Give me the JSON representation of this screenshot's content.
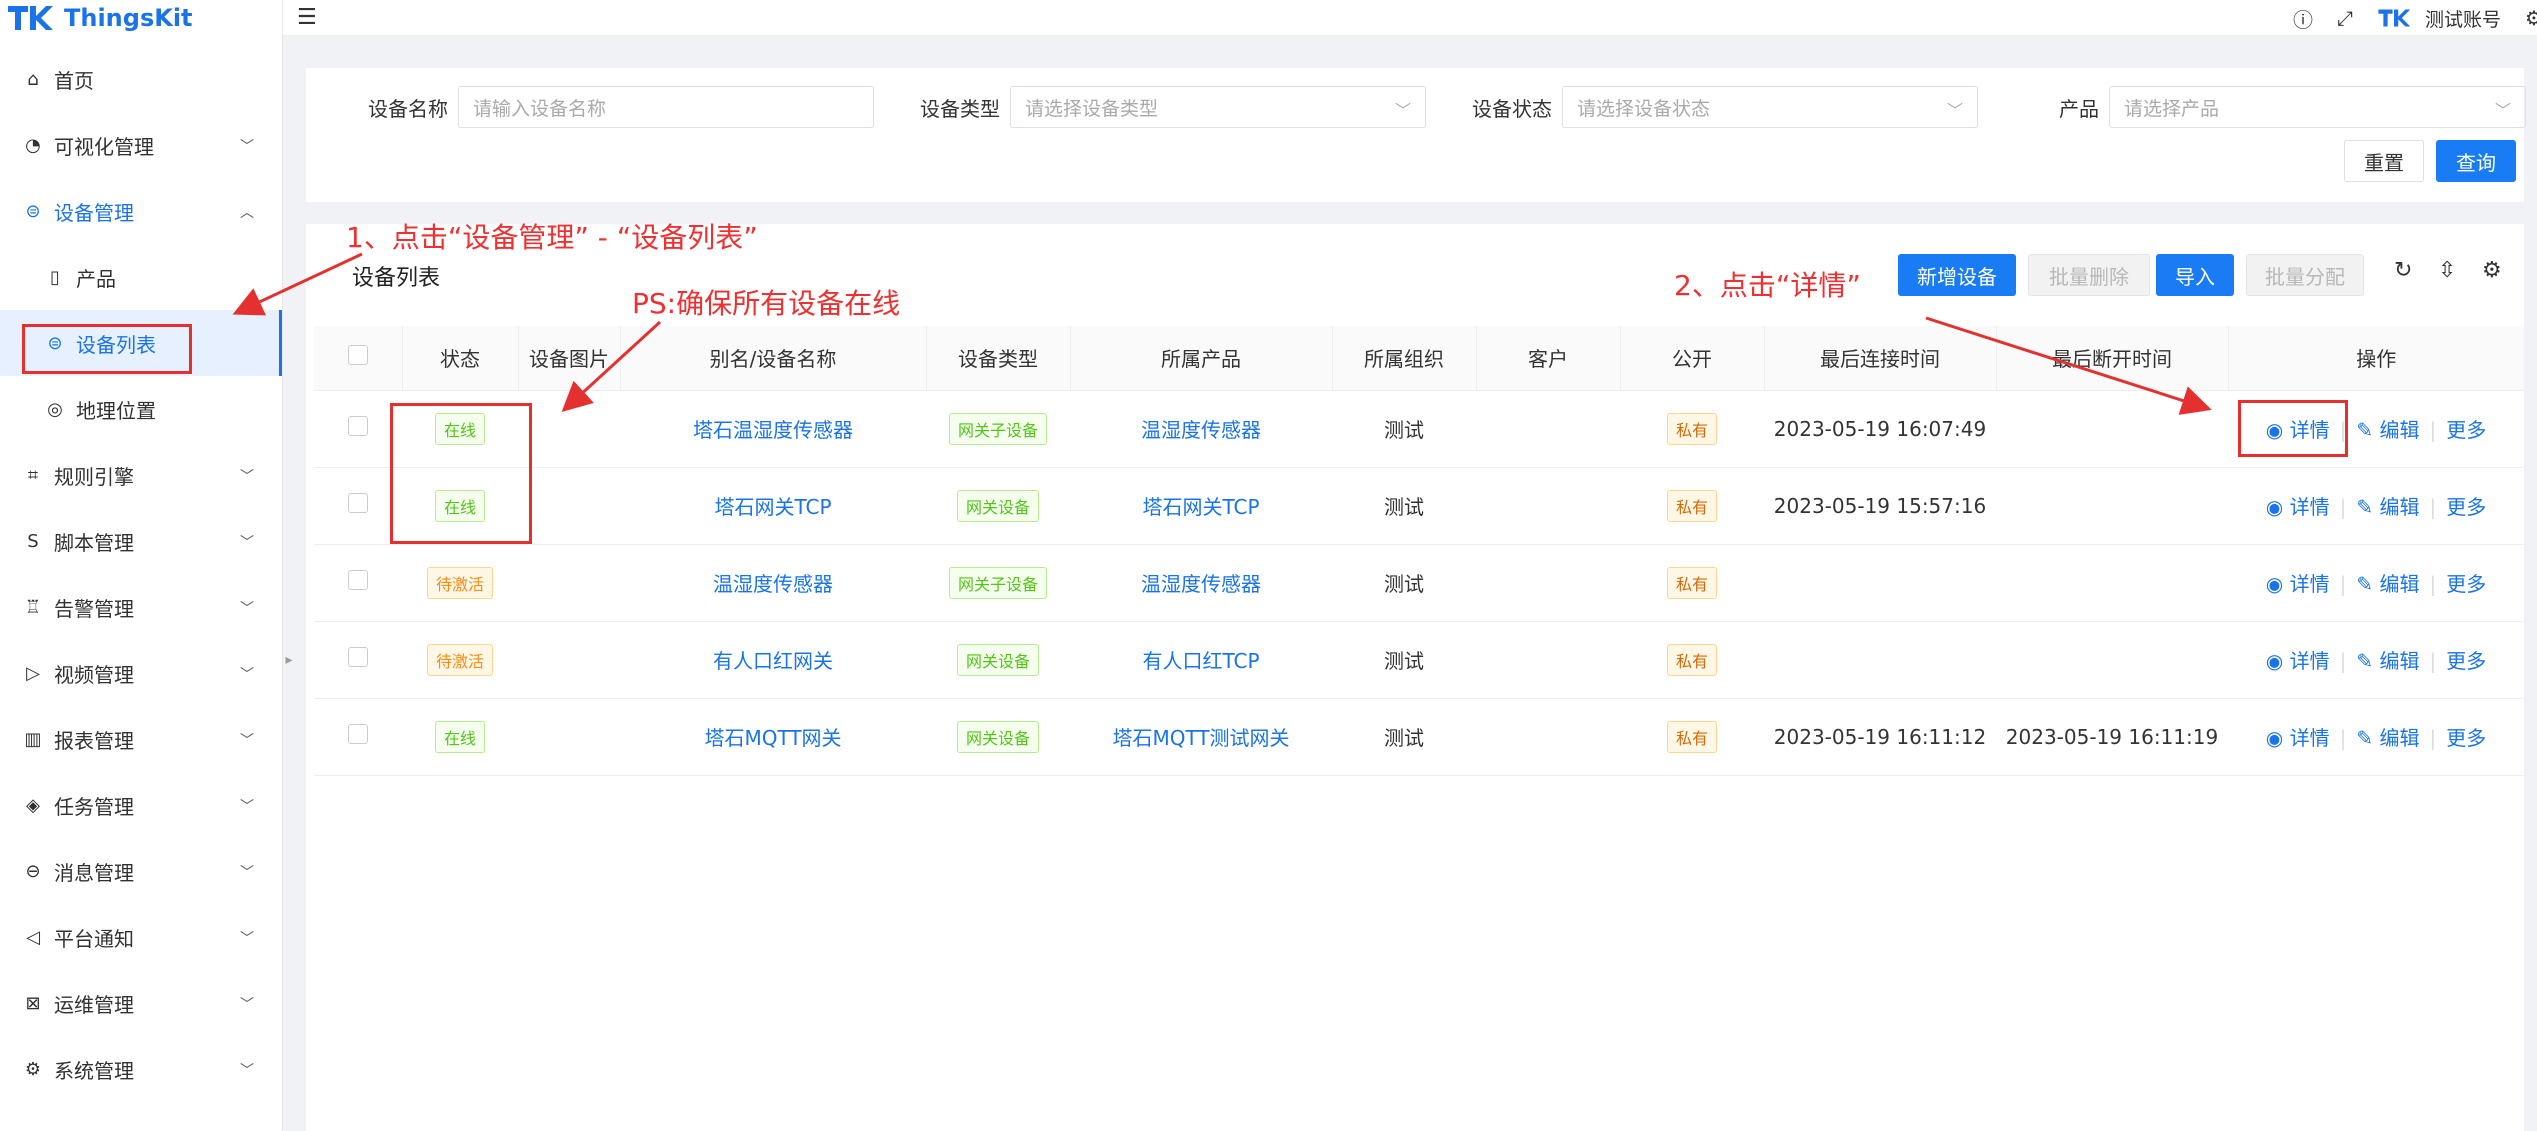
{
  "app": {
    "name": "ThingsKit",
    "account": "测试账号"
  },
  "sidebar": {
    "items": [
      {
        "label": "首页",
        "icon": "home-icon",
        "glyph": "⌂"
      },
      {
        "label": "可视化管理",
        "icon": "dashboard-icon",
        "glyph": "◔"
      },
      {
        "label": "设备管理",
        "icon": "device-icon",
        "glyph": "⊜"
      },
      {
        "label": "产品",
        "icon": "file-icon",
        "glyph": "▯"
      },
      {
        "label": "设备列表",
        "icon": "device-list-icon",
        "glyph": "⊜"
      },
      {
        "label": "地理位置",
        "icon": "location-icon",
        "glyph": "◎"
      },
      {
        "label": "规则引擎",
        "icon": "rule-icon",
        "glyph": "⌗"
      },
      {
        "label": "脚本管理",
        "icon": "script-icon",
        "glyph": "S"
      },
      {
        "label": "告警管理",
        "icon": "alarm-icon",
        "glyph": "♖"
      },
      {
        "label": "视频管理",
        "icon": "video-icon",
        "glyph": "▷"
      },
      {
        "label": "报表管理",
        "icon": "report-icon",
        "glyph": "▥"
      },
      {
        "label": "任务管理",
        "icon": "task-icon",
        "glyph": "◈"
      },
      {
        "label": "消息管理",
        "icon": "message-icon",
        "glyph": "⊖"
      },
      {
        "label": "平台通知",
        "icon": "notice-icon",
        "glyph": "◁"
      },
      {
        "label": "运维管理",
        "icon": "ops-icon",
        "glyph": "⊠"
      },
      {
        "label": "系统管理",
        "icon": "settings-icon",
        "glyph": "⚙"
      }
    ]
  },
  "search": {
    "device_name_label": "设备名称",
    "device_name_placeholder": "请输入设备名称",
    "device_type_label": "设备类型",
    "device_type_placeholder": "请选择设备类型",
    "device_status_label": "设备状态",
    "device_status_placeholder": "请选择设备状态",
    "product_label": "产品",
    "product_placeholder": "请选择产品",
    "reset": "重置",
    "query": "查询"
  },
  "table": {
    "title": "设备列表",
    "actions": {
      "add": "新增设备",
      "batch_delete": "批量删除",
      "import": "导入",
      "batch_assign": "批量分配"
    },
    "columns": [
      "状态",
      "设备图片",
      "别名/设备名称",
      "设备类型",
      "所属产品",
      "所属组织",
      "客户",
      "公开",
      "最后连接时间",
      "最后断开时间",
      "操作"
    ],
    "ops": {
      "detail": "详情",
      "edit": "编辑",
      "more": "更多"
    },
    "rows": [
      {
        "status": "在线",
        "status_type": "online",
        "name": "塔石温湿度传感器",
        "type": "网关子设备",
        "product": "温湿度传感器",
        "org": "测试",
        "customer": "",
        "public": "私有",
        "last_connect": "2023-05-19 16:07:49",
        "last_disconnect": ""
      },
      {
        "status": "在线",
        "status_type": "online",
        "name": "塔石网关TCP",
        "type": "网关设备",
        "product": "塔石网关TCP",
        "org": "测试",
        "customer": "",
        "public": "私有",
        "last_connect": "2023-05-19 15:57:16",
        "last_disconnect": ""
      },
      {
        "status": "待激活",
        "status_type": "pending",
        "name": "温湿度传感器",
        "type": "网关子设备",
        "product": "温湿度传感器",
        "org": "测试",
        "customer": "",
        "public": "私有",
        "last_connect": "",
        "last_disconnect": ""
      },
      {
        "status": "待激活",
        "status_type": "pending",
        "name": "有人口红网关",
        "type": "网关设备",
        "product": "有人口红TCP",
        "org": "测试",
        "customer": "",
        "public": "私有",
        "last_connect": "",
        "last_disconnect": ""
      },
      {
        "status": "在线",
        "status_type": "online",
        "name": "塔石MQTT网关",
        "type": "网关设备",
        "product": "塔石MQTT测试网关",
        "org": "测试",
        "customer": "",
        "public": "私有",
        "last_connect": "2023-05-19 16:11:12",
        "last_disconnect": "2023-05-19 16:11:19"
      }
    ]
  },
  "annotations": {
    "step1": "1、点击“设备管理” - “设备列表”",
    "ps": "PS:确保所有设备在线",
    "step2": "2、点击“详情”",
    "color": "#f03030"
  },
  "colors": {
    "primary": "#1a73e8",
    "online": "#52c41a",
    "pending": "#fa8c16"
  }
}
